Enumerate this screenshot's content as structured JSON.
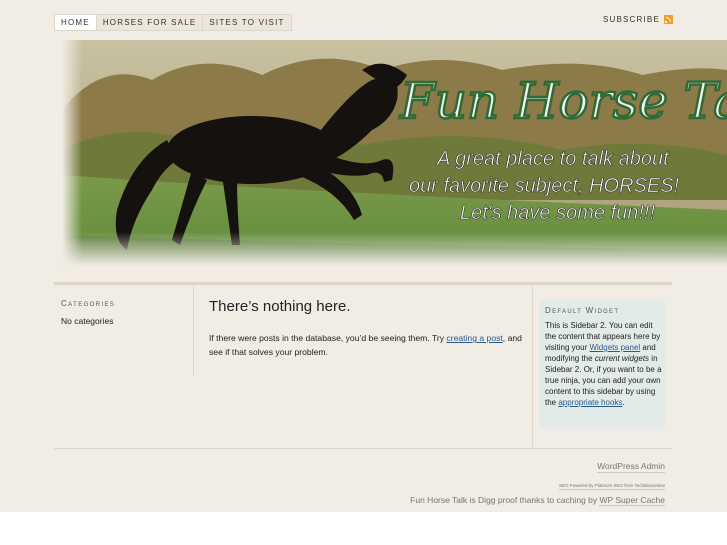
{
  "nav": {
    "items": [
      "Home",
      "Horses for Sale",
      "Sites to Visit"
    ],
    "subscribe_label": "Subscribe"
  },
  "header": {
    "title": "Fun Horse Tal",
    "tagline_line1": "A great place to talk about",
    "tagline_line2": "our favorite subject, HORSES!",
    "tagline_line3": "Let's have some fun!!!"
  },
  "left_sidebar": {
    "title": "Categories",
    "empty_text": "No categories"
  },
  "content": {
    "heading": "There’s nothing here.",
    "text_before": "If there were posts in the database, you’d be seeing them. Try ",
    "link_text": "creating a post",
    "text_after": ", and see if that solves your problem."
  },
  "widget": {
    "title": "Default Widget",
    "t1": "This is Sidebar 2. You can edit the content that appears here by visiting your ",
    "link1": "Widgets panel",
    "t2": " and modifying the ",
    "em": "current widgets",
    "t3": " in Sidebar 2. Or, if you want to be a true ninja, you can add your own content to this sidebar by using the ",
    "link2": "appropriate hooks",
    "t4": "."
  },
  "footer": {
    "admin": "WordPress Admin",
    "seo": "SEO Powered by Platinum SEO from Techblissonline",
    "cache_text": "Fun Horse Talk is Digg proof thanks to caching by ",
    "cache_link": "WP Super Cache"
  },
  "colors": {
    "page_bg": "#f1ece4",
    "widget_bg": "#e2ebe8",
    "link": "#2a5a8c",
    "rss": "#f29b2c"
  }
}
